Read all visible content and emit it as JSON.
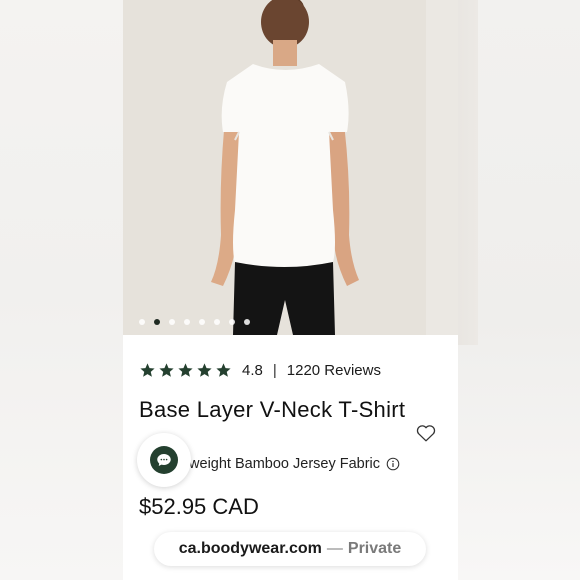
{
  "product": {
    "image_alt": "Woman wearing white base layer t-shirt, back view",
    "carousel_count": 8,
    "carousel_active_index": 1,
    "rating": "4.8",
    "rating_separator": "|",
    "review_count": "1220 Reviews",
    "star_count": 5,
    "title": "Base Layer V-Neck T-Shirt",
    "subtitle": "tweight Bamboo Jersey Fabric",
    "price": "$52.95 CAD"
  },
  "browser": {
    "domain": "ca.boodywear.com",
    "separator": "—",
    "mode": "Private"
  },
  "colors": {
    "accent_green": "#24402f",
    "star_color": "#24402f"
  },
  "icons": {
    "heart": "heart-outline-icon",
    "info": "info-circle-icon",
    "chat": "chat-bubble-icon",
    "star": "star-icon"
  }
}
